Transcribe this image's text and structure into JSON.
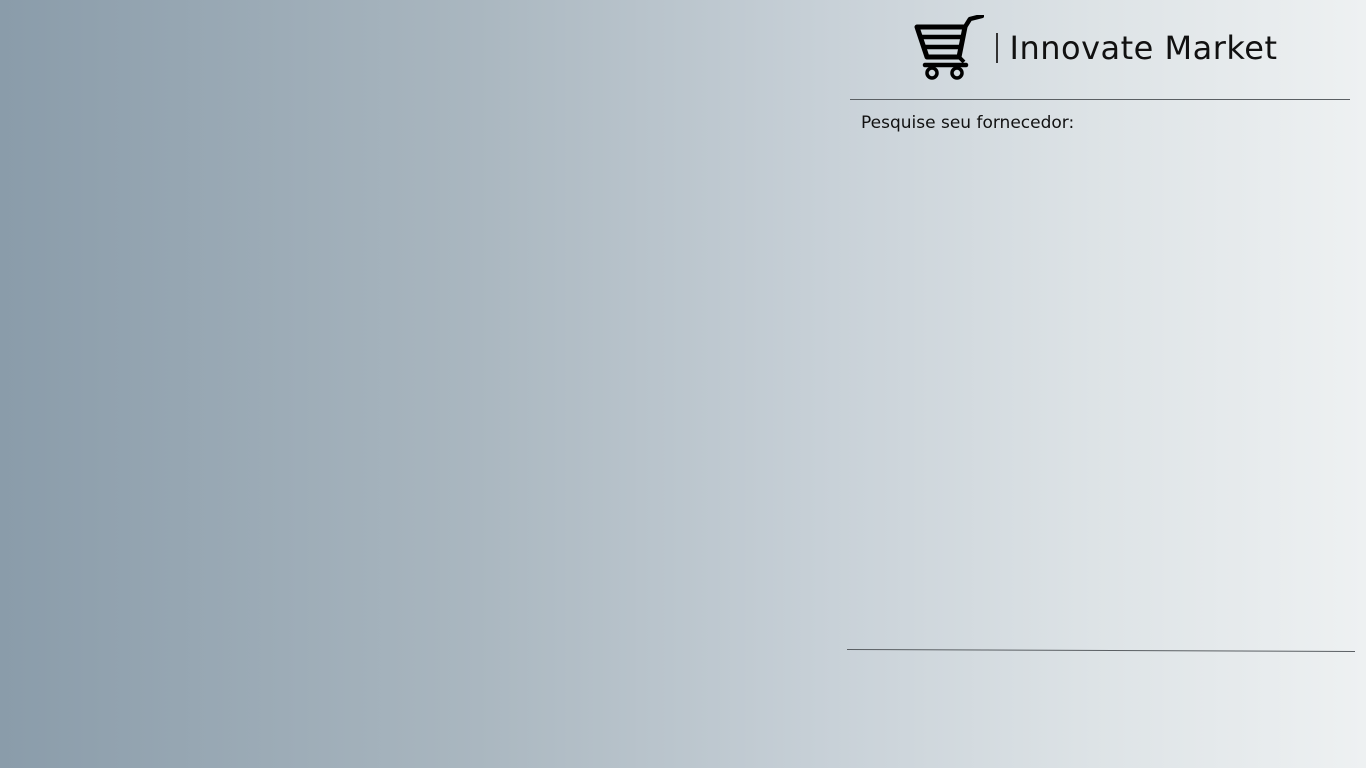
{
  "brand": {
    "logo_icon": "shopping-cart-icon",
    "name": "Innovate Market"
  },
  "search": {
    "label": "Pesquise seu fornecedor:"
  }
}
